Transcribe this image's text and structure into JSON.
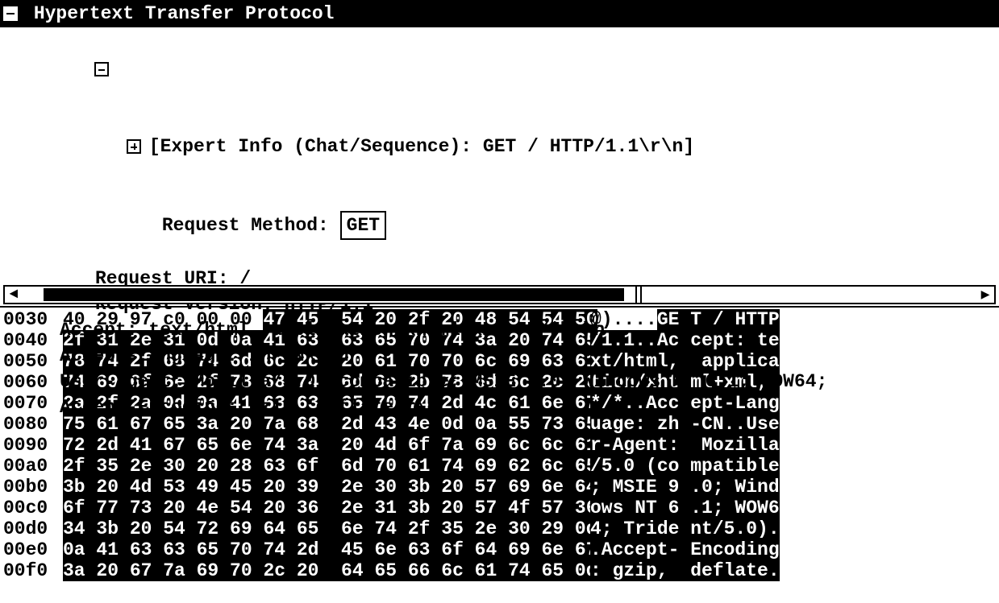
{
  "header": {
    "title": "Hypertext Transfer Protocol"
  },
  "details": {
    "expert_info": "[Expert Info (Chat/Sequence): GET / HTTP/1.1\\r\\n]",
    "method_label": "Request Method: ",
    "method_value": "GET",
    "uri_line": "Request URI: /",
    "version_line": "Request Version: HTTP/1.1",
    "accept_line": "Accept: text/html, application/xhtml+xml, */*\\r\\n",
    "accept_lang_line": "Accept-Language: zh-CN\\r\\n",
    "user_agent_line": "User-Agent: Mozilla/5.0 (compatible; MSIE 9.0; Windows NT 6.1; WOW64;",
    "accept_enc_line": "Accept-Encoding: gzip, deflate\\r\\n"
  },
  "hex": {
    "rows": [
      {
        "offset": "0030",
        "pre": "40 29 97 c0 00 00 ",
        "hl": "47 45  54 20 2f 20 48 54 54 50",
        "apre": "@)....",
        "ahl": "GE T / HTTP"
      },
      {
        "offset": "0040",
        "hl": "2f 31 2e 31 0d 0a 41 63  63 65 70 74 3a 20 74 65",
        "ahl": "/1.1..Ac cept: te"
      },
      {
        "offset": "0050",
        "hl": "78 74 2f 68 74 6d 6c 2c  20 61 70 70 6c 69 63 61",
        "ahl": "xt/html,  applica"
      },
      {
        "offset": "0060",
        "hl": "74 69 6f 6e 2f 78 68 74  6d 6c 2b 78 6d 6c 2c 20",
        "ahl": "tion/xht ml+xml, "
      },
      {
        "offset": "0070",
        "hl": "2a 2f 2a 0d 0a 41 63 63  65 70 74 2d 4c 61 6e 67",
        "ahl": "*/*..Acc ept-Lang"
      },
      {
        "offset": "0080",
        "hl": "75 61 67 65 3a 20 7a 68  2d 43 4e 0d 0a 55 73 65",
        "ahl": "uage: zh -CN..Use"
      },
      {
        "offset": "0090",
        "hl": "72 2d 41 67 65 6e 74 3a  20 4d 6f 7a 69 6c 6c 61",
        "ahl": "r-Agent:  Mozilla"
      },
      {
        "offset": "00a0",
        "hl": "2f 35 2e 30 20 28 63 6f  6d 70 61 74 69 62 6c 65",
        "ahl": "/5.0 (co mpatible"
      },
      {
        "offset": "00b0",
        "hl": "3b 20 4d 53 49 45 20 39  2e 30 3b 20 57 69 6e 64",
        "ahl": "; MSIE 9 .0; Wind"
      },
      {
        "offset": "00c0",
        "hl": "6f 77 73 20 4e 54 20 36  2e 31 3b 20 57 4f 57 36",
        "ahl": "ows NT 6 .1; WOW6"
      },
      {
        "offset": "00d0",
        "hl": "34 3b 20 54 72 69 64 65  6e 74 2f 35 2e 30 29 0d",
        "ahl": "4; Tride nt/5.0)."
      },
      {
        "offset": "00e0",
        "hl": "0a 41 63 63 65 70 74 2d  45 6e 63 6f 64 69 6e 67",
        "ahl": ".Accept- Encoding"
      },
      {
        "offset": "00f0",
        "hl": "3a 20 67 7a 69 70 2c 20  64 65 66 6c 61 74 65 0d",
        "ahl": ": gzip,  deflate."
      }
    ]
  }
}
